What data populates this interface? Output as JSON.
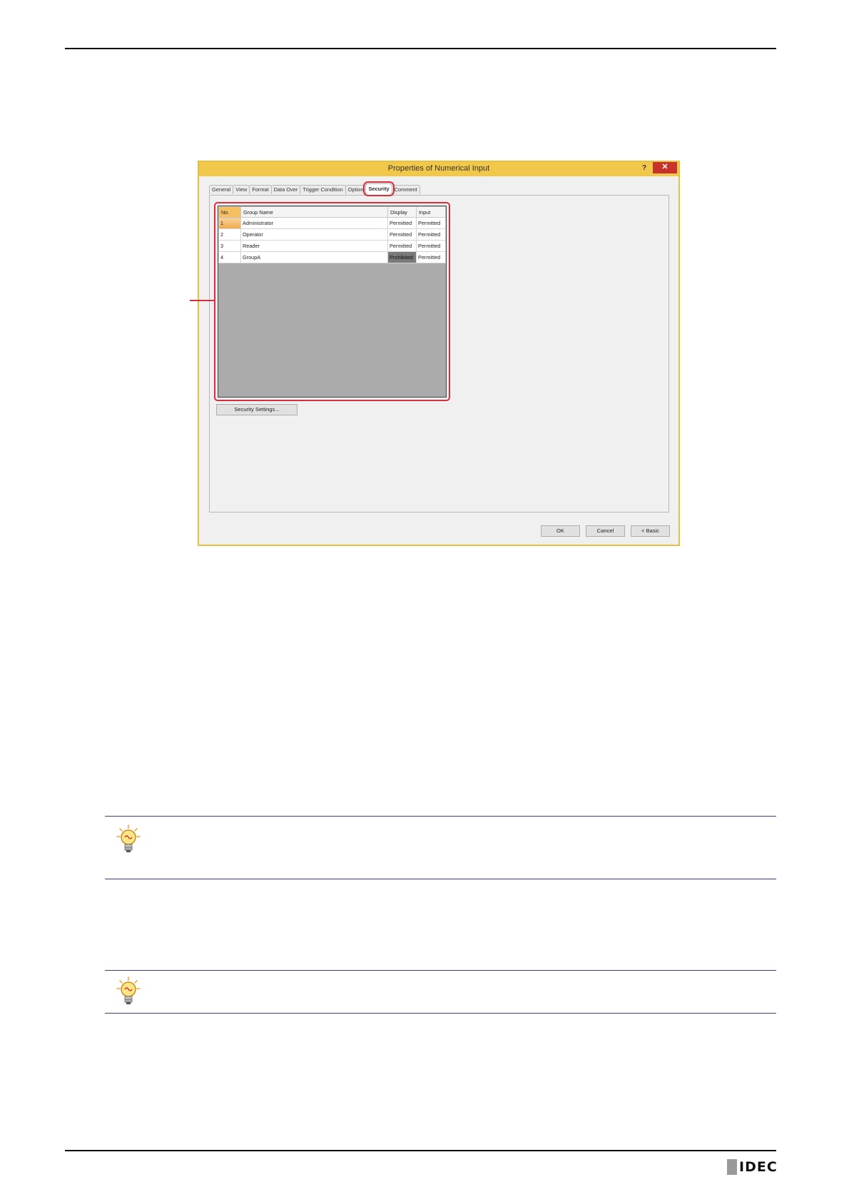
{
  "dialog": {
    "title": "Properties of Numerical Input",
    "help_label": "?",
    "close_label": "✕",
    "tabs": [
      "General",
      "View",
      "Format",
      "Data Over",
      "Trigger Condition",
      "Option",
      "Security",
      "Comment"
    ],
    "active_tab": "Security"
  },
  "security_table": {
    "headers": [
      "No.",
      "Group Name",
      "Display",
      "Input"
    ],
    "rows": [
      {
        "no": "1",
        "group": "Administrator",
        "display": "Permitted",
        "input": "Permitted"
      },
      {
        "no": "2",
        "group": "Operator",
        "display": "Permitted",
        "input": "Permitted"
      },
      {
        "no": "3",
        "group": "Reader",
        "display": "Permitted",
        "input": "Permitted"
      },
      {
        "no": "4",
        "group": "GroupA",
        "display": "Prohibited",
        "input": "Permitted"
      }
    ]
  },
  "buttons": {
    "security_settings": "Security Settings...",
    "ok": "OK",
    "cancel": "Cancel",
    "basic": "< Basic"
  },
  "colors": {
    "highlight": "#d62f3d",
    "titlebar": "#f2c84a",
    "note_rule": "#3c3c8c"
  },
  "icons": [
    "lightbulb-tip-icon",
    "lightbulb-tip-icon"
  ],
  "footer": {
    "logo": "IDEC"
  }
}
